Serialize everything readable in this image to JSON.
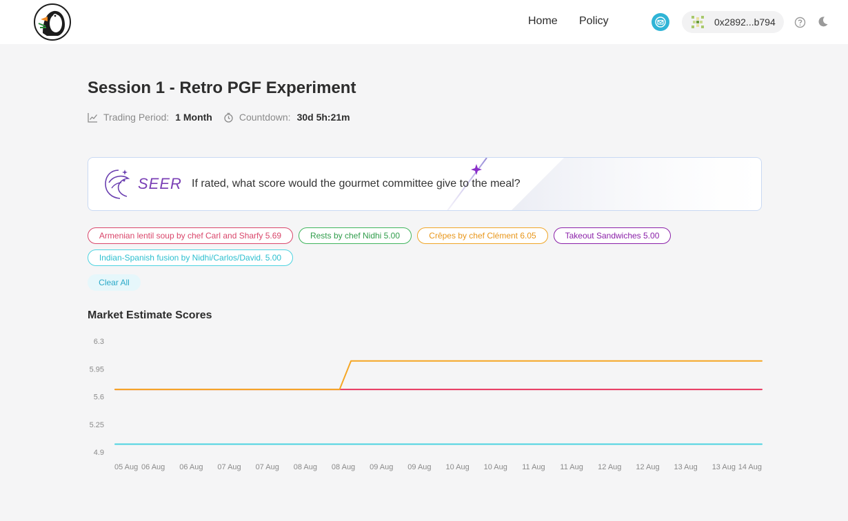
{
  "header": {
    "nav": [
      {
        "label": "Home"
      },
      {
        "label": "Policy"
      }
    ],
    "wallet_address": "0x2892...b794",
    "icons": [
      "puffin-logo-icon",
      "mail-icon",
      "wallet-avatar-icon",
      "help-icon",
      "moon-icon"
    ]
  },
  "page": {
    "title": "Session 1 - Retro PGF Experiment",
    "trading_period_label": "Trading Period:",
    "trading_period_value": "1 Month",
    "countdown_label": "Countdown:",
    "countdown_value": "30d 5h:21m"
  },
  "question": {
    "brand": "SEER",
    "text": "If rated, what score would the gourmet committee give to the meal?"
  },
  "filters": [
    {
      "label": "Armenian lentil soup by chef Carl and Sharfy 5.69",
      "color": "#d9456a"
    },
    {
      "label": "Rests by chef Nidhi 5.00",
      "color": "#3fb45c"
    },
    {
      "label": "Crêpes by chef Clément 6.05",
      "color": "#f0a526"
    },
    {
      "label": "Takeout Sandwiches 5.00",
      "color": "#8a1fa8"
    },
    {
      "label": "Indian-Spanish fusion by Nidhi/Carlos/David. 5.00",
      "color": "#4cd3e0"
    }
  ],
  "clear_all_label": "Clear All",
  "chart_title": "Market Estimate Scores",
  "chart_data": {
    "type": "line",
    "title": "Market Estimate Scores",
    "xlabel": "",
    "ylabel": "",
    "ylim": [
      4.9,
      6.3
    ],
    "yticks": [
      "6.3",
      "5.95",
      "5.6",
      "5.25",
      "4.9"
    ],
    "xticks": [
      "05 Aug",
      "06 Aug",
      "06 Aug",
      "07 Aug",
      "07 Aug",
      "08 Aug",
      "08 Aug",
      "09 Aug",
      "09 Aug",
      "10 Aug",
      "10 Aug",
      "11 Aug",
      "11 Aug",
      "12 Aug",
      "12 Aug",
      "13 Aug",
      "13 Aug",
      "14 Aug"
    ],
    "grid": false,
    "series": [
      {
        "name": "Armenian lentil soup by chef Carl and Sharfy",
        "color": "#e8365d",
        "points": [
          [
            0,
            5.69
          ],
          [
            17,
            5.69
          ]
        ]
      },
      {
        "name": "Crêpes by chef Clément",
        "color": "#f5a623",
        "points": [
          [
            0,
            5.69
          ],
          [
            5.9,
            5.69
          ],
          [
            6.2,
            6.05
          ],
          [
            17,
            6.05
          ]
        ]
      },
      {
        "name": "Indian-Spanish fusion by Nidhi/Carlos/David.",
        "color": "#4cd3e0",
        "points": [
          [
            0,
            5.0
          ],
          [
            17,
            5.0
          ]
        ]
      }
    ]
  }
}
